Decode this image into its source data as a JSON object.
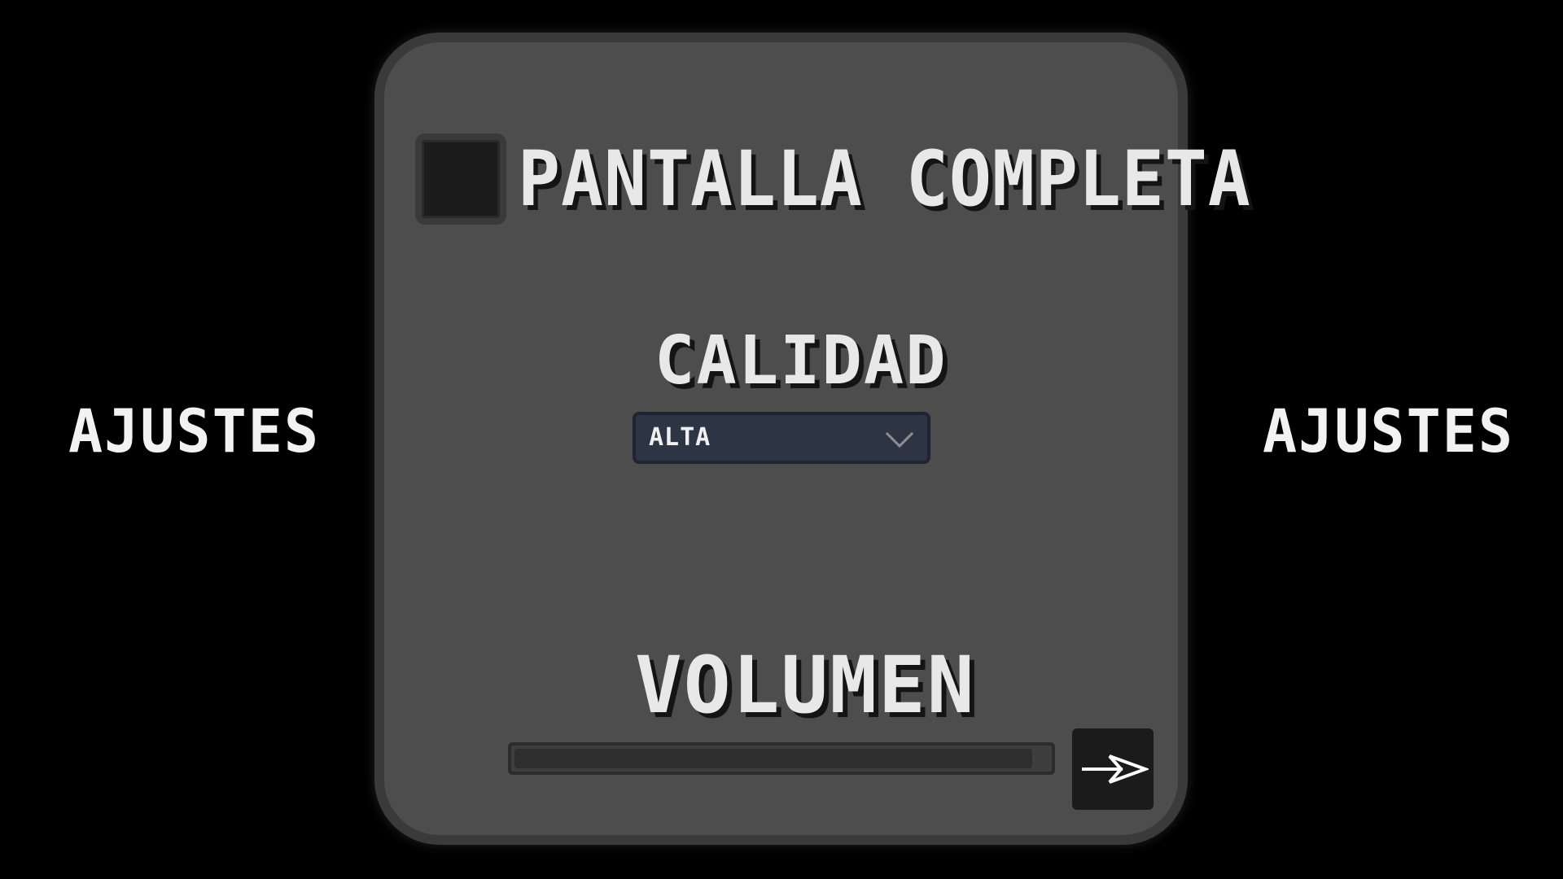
{
  "side_titles": {
    "left": "AJUSTES",
    "right": "AJUSTES"
  },
  "settings": {
    "fullscreen": {
      "label": "PANTALLA COMPLETA",
      "checked": false
    },
    "quality": {
      "label": "CALIDAD",
      "selected": "ALTA"
    },
    "volume": {
      "label": "VOLUMEN",
      "level": 0.97
    }
  },
  "icons": {
    "dropdown": "chevron-down-icon",
    "next": "arrow-right-icon"
  },
  "colors": {
    "background": "#000000",
    "panel": "#4d4d4d",
    "dropdown": "#2d3443",
    "text": "#e8e8e8"
  }
}
